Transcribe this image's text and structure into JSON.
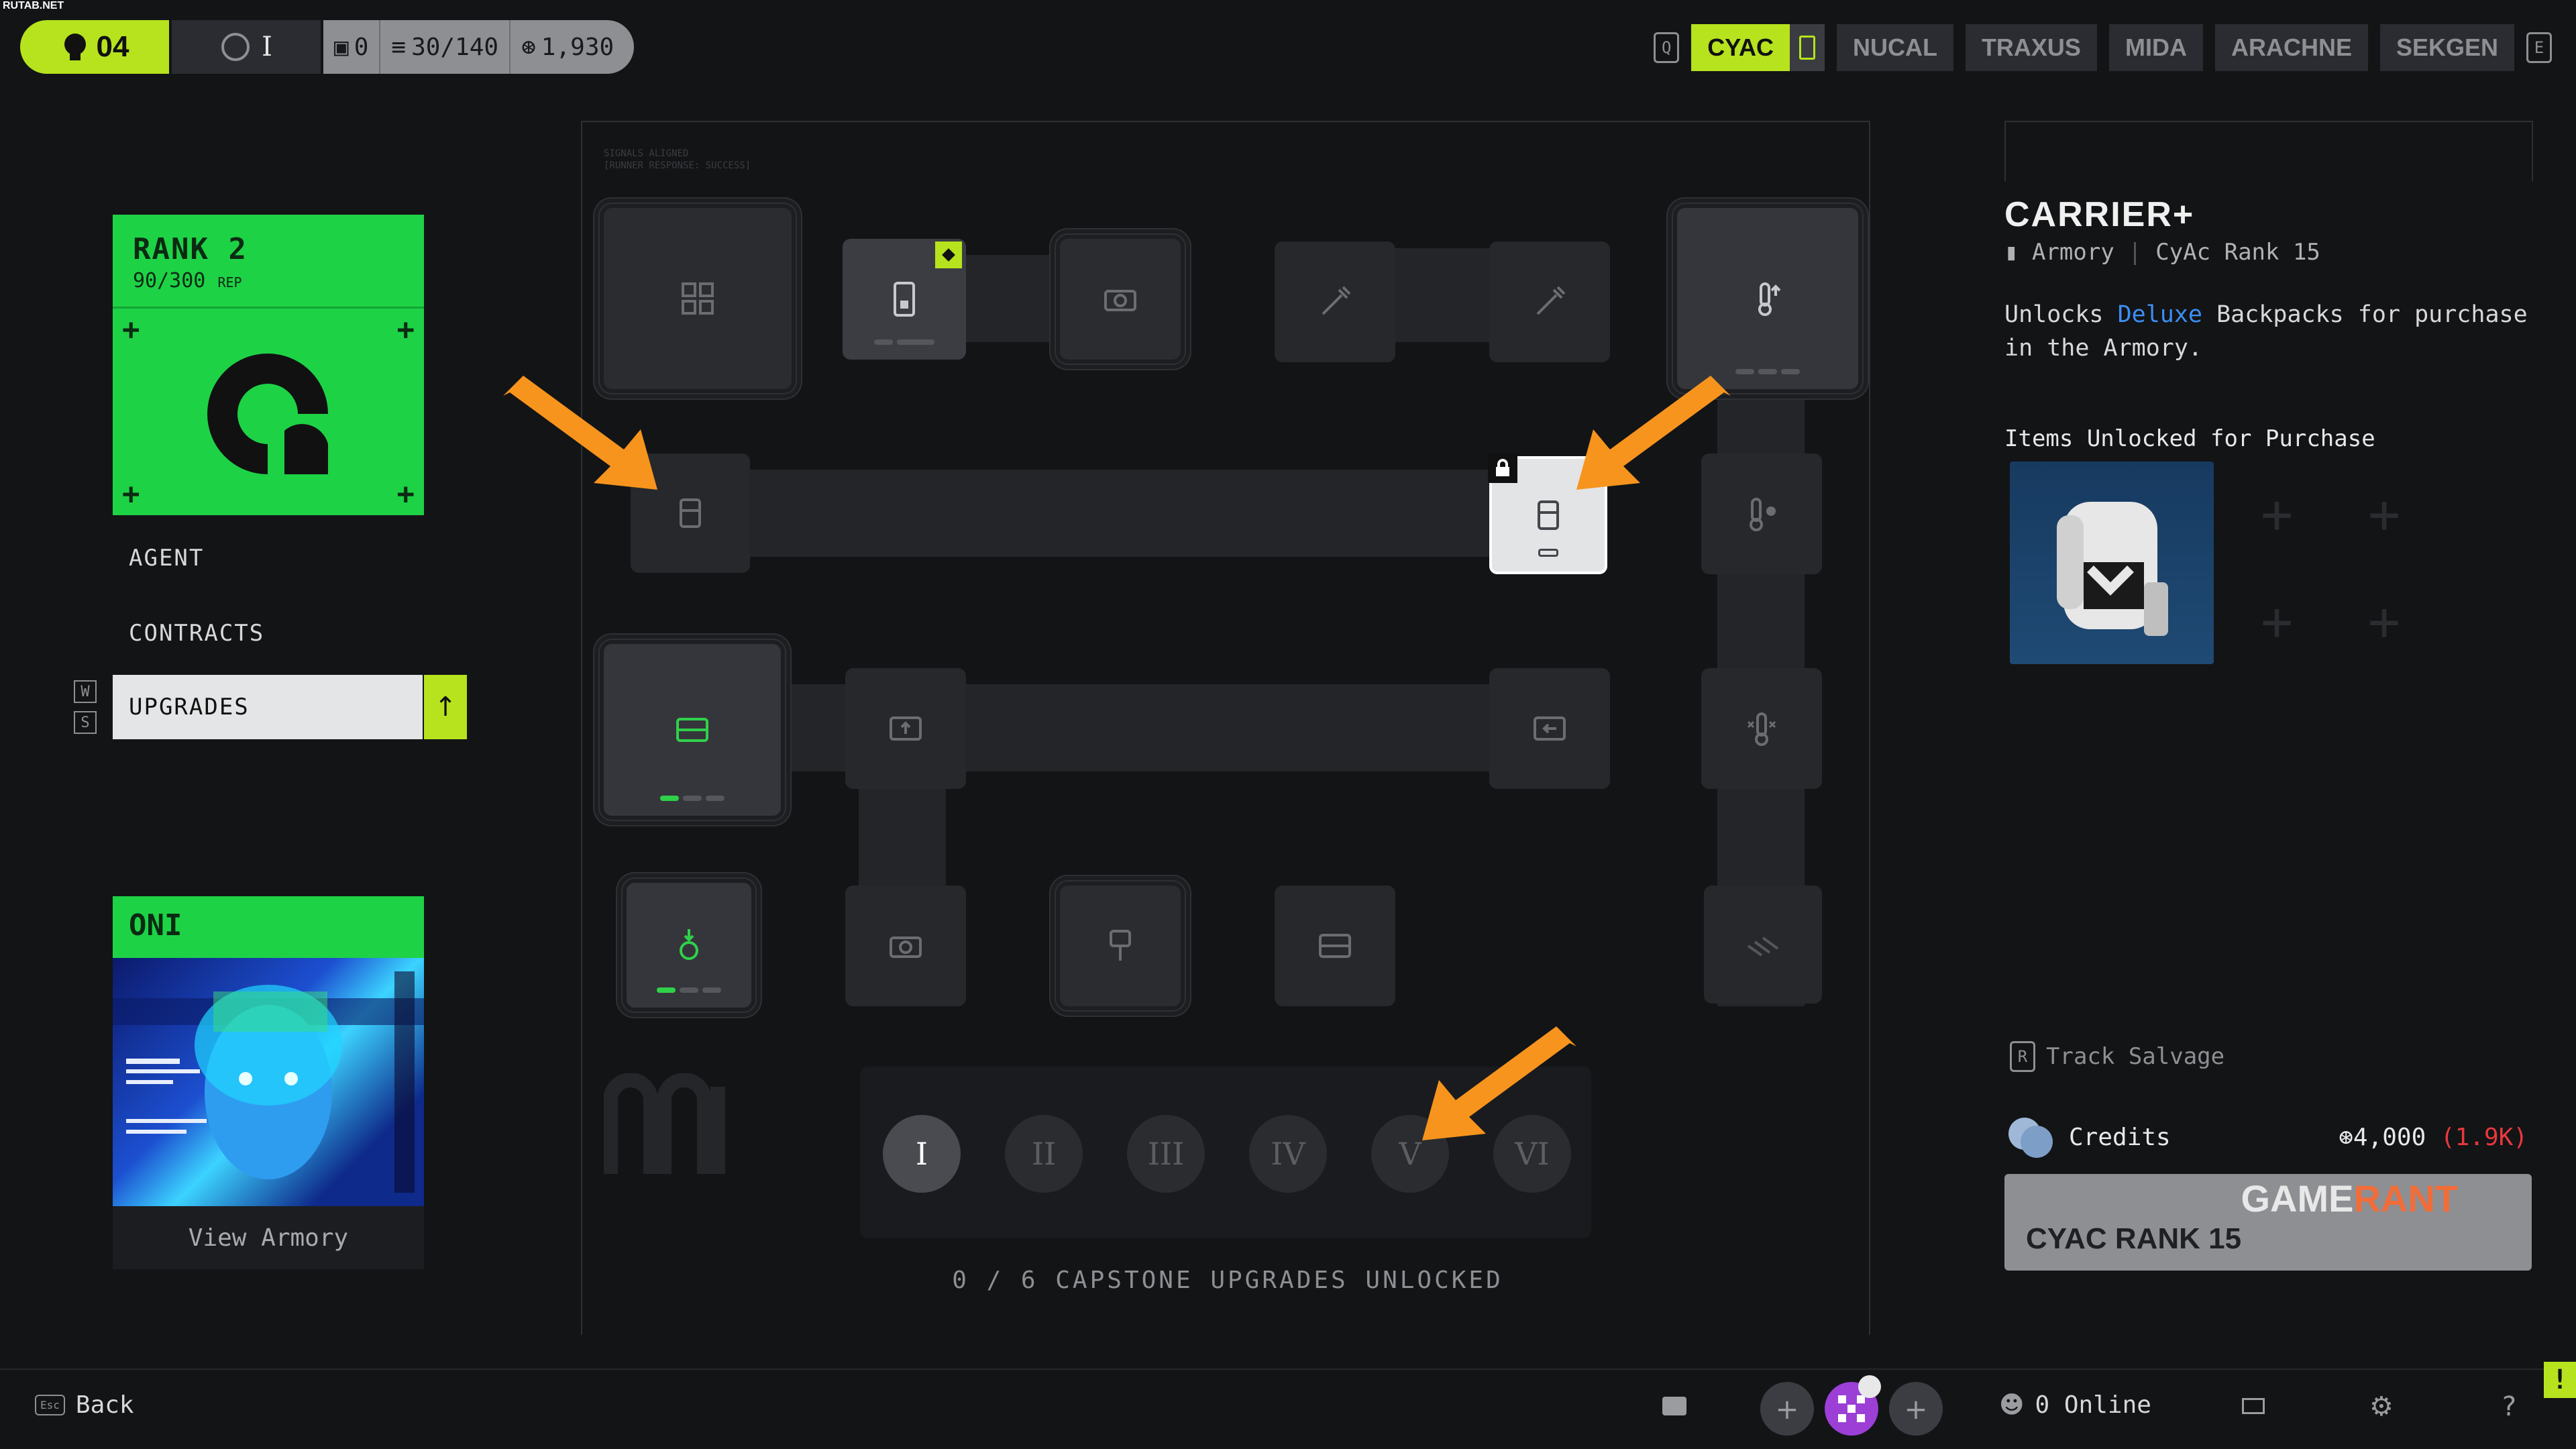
{
  "watermark": "RUTAB.NET",
  "topbar": {
    "level": "04",
    "rank_numeral": "I",
    "stats": [
      {
        "icon": "box-icon",
        "value": "0"
      },
      {
        "icon": "stack-icon",
        "value": "30/140"
      },
      {
        "icon": "credit-icon",
        "value": "1,930"
      }
    ],
    "factions": [
      "CYAC",
      "NUCAL",
      "TRAXUS",
      "MIDA",
      "ARACHNE",
      "SEKGEN"
    ],
    "active_faction": "CYAC",
    "key_prev": "Q",
    "key_next": "E"
  },
  "left": {
    "rank": {
      "title": "RANK 2",
      "rep": "90/300",
      "rep_unit": "REP"
    },
    "nav": [
      "AGENT",
      "CONTRACTS",
      "UPGRADES"
    ],
    "active_nav": "UPGRADES",
    "keys": [
      "W",
      "S"
    ],
    "agent": {
      "name": "ONI",
      "link": "View Armory"
    }
  },
  "tree": {
    "capstones": [
      "I",
      "II",
      "III",
      "IV",
      "V",
      "VI"
    ],
    "capstone_active": "I",
    "capstone_status": "0 / 6 CAPSTONE UPGRADES UNLOCKED"
  },
  "right": {
    "title": "CARRIER+",
    "sub_source": "Armory",
    "sub_rank": "CyAc Rank 15",
    "desc_pre": "Unlocks ",
    "desc_highlight": "Deluxe",
    "desc_post": " Backpacks for purchase in the Armory.",
    "items_heading": "Items Unlocked for Purchase",
    "track_key": "R",
    "track_label": "Track Salvage",
    "credits_label": "Credits",
    "credits_value": "4,000",
    "credits_have": "(1.9K)",
    "cost_label": "CYAC RANK 15",
    "watermark_a": "GAME",
    "watermark_b": "RANT"
  },
  "bottom": {
    "back_key": "Esc",
    "back_label": "Back",
    "online_label": "0 Online"
  },
  "colors": {
    "accent": "#b6e31e",
    "rank_green": "#1ed246",
    "arrow": "#f7941d",
    "deficit": "#e8383d",
    "highlight": "#3c8ff4"
  }
}
